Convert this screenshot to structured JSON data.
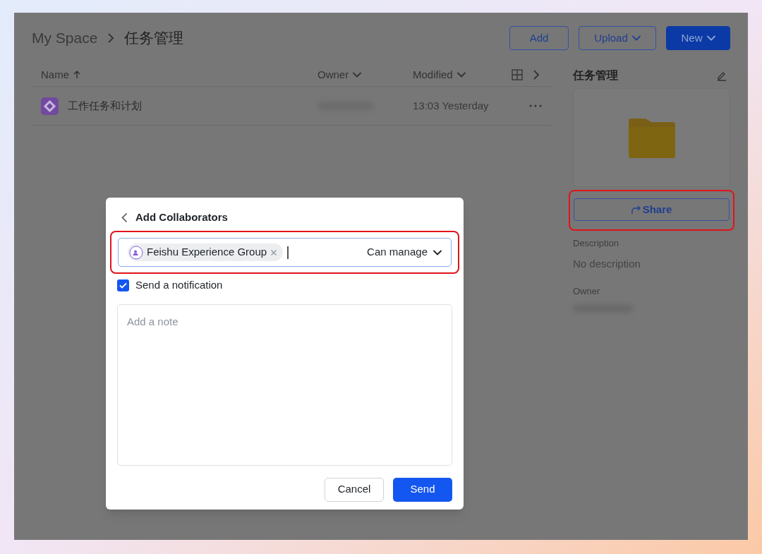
{
  "breadcrumb": [
    "My Space",
    "任务管理"
  ],
  "toolbar": {
    "buttons": [
      {
        "label": "Add",
        "kind": "outline",
        "dropdown": false
      },
      {
        "label": "Upload",
        "kind": "outline",
        "dropdown": true
      },
      {
        "label": "New",
        "kind": "primary",
        "dropdown": true
      }
    ]
  },
  "table": {
    "columns": [
      {
        "label": "Name",
        "sorted": true
      },
      {
        "label": "Owner",
        "sorted": false
      },
      {
        "label": "Modified",
        "sorted": false
      }
    ],
    "rows": [
      {
        "name": "工作任务和计划",
        "modified": "13:03 Yesterday"
      }
    ]
  },
  "details": {
    "title": "任务管理",
    "share": {
      "label": "Share",
      "highlighted": true
    },
    "description_label": "Description",
    "description": "No description",
    "owner_label": "Owner"
  },
  "dialog": {
    "title": "Add Collaborators",
    "highlighted": true,
    "chips": [
      {
        "label": "Feishu Experience Group",
        "kind": "group"
      }
    ],
    "permission": "Can manage",
    "notify": {
      "label": "Send a notification",
      "checked": true
    },
    "note": {
      "placeholder": "Add a note"
    },
    "buttons": [
      {
        "label": "Cancel",
        "kind": "outline"
      },
      {
        "label": "Send",
        "kind": "primary"
      }
    ]
  }
}
